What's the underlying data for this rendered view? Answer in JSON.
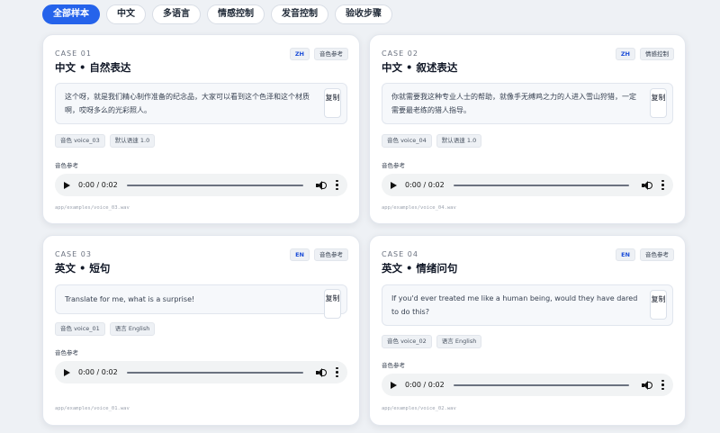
{
  "tabs": [
    "全部样本",
    "中文",
    "多语言",
    "情感控制",
    "发音控制",
    "验收步骤"
  ],
  "copy_label": "复制",
  "audio": {
    "time": "0:00 / 0:02"
  },
  "cases": [
    {
      "case_label": "CASE 01",
      "title": "中文 • 自然表达",
      "lang_badge": "ZH",
      "tag": "音色参考",
      "text": "这个呀，就是我们精心制作准备的纪念品，大家可以看到这个色泽和这个材质啊，哎呀多么的光彩照人。",
      "chips": [
        "音色 voice_03",
        "默认语速 1.0"
      ],
      "audio_label": "音色参考",
      "path": "app/examples/voice_03.wav"
    },
    {
      "case_label": "CASE 02",
      "title": "中文 • 叙述表达",
      "lang_badge": "ZH",
      "tag": "情感控制",
      "text": "你就需要我这种专业人士的帮助，就像手无缚鸡之力的人进入雪山狩猎，一定需要最老练的猎人指导。",
      "chips": [
        "音色 voice_04",
        "默认语速 1.0"
      ],
      "audio_label": "音色参考",
      "path": "app/examples/voice_04.wav"
    },
    {
      "case_label": "CASE 03",
      "title": "英文 • 短句",
      "lang_badge": "EN",
      "tag": "音色参考",
      "text": "Translate for me, what is a surprise!",
      "chips": [
        "音色 voice_01",
        "语言 English"
      ],
      "audio_label": "音色参考",
      "path": "app/examples/voice_01.wav"
    },
    {
      "case_label": "CASE 04",
      "title": "英文 • 情绪问句",
      "lang_badge": "EN",
      "tag": "音色参考",
      "text": "If you'd ever treated me like a human being, would they have dared to do this?",
      "chips": [
        "音色 voice_02",
        "语言 English"
      ],
      "audio_label": "音色参考",
      "path": "app/examples/voice_02.wav"
    }
  ]
}
